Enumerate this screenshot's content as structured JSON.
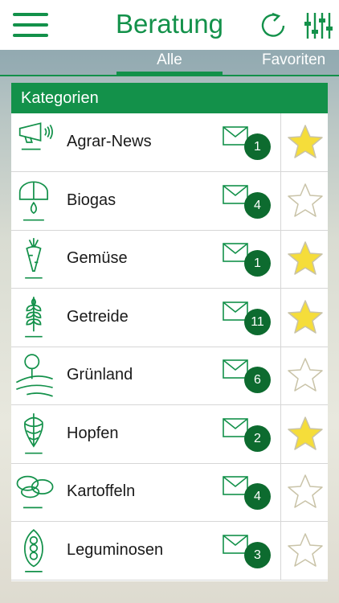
{
  "header": {
    "title": "Beratung",
    "menu_icon": "hamburger-menu-icon",
    "refresh_icon": "refresh-icon",
    "filter_icon": "sliders-icon"
  },
  "tabs": [
    {
      "label": "Alle",
      "active": true
    },
    {
      "label": "Favoriten",
      "active": false
    }
  ],
  "section": {
    "title": "Kategorien"
  },
  "colors": {
    "brand_green": "#13914a",
    "badge_green": "#0d6b2f",
    "star_filled": "#f5dd3a",
    "star_empty": "#ffffff"
  },
  "categories": [
    {
      "label": "Agrar-News",
      "count": "1",
      "favorite": true,
      "icon": "megaphone-icon"
    },
    {
      "label": "Biogas",
      "count": "4",
      "favorite": false,
      "icon": "biogas-tank-icon"
    },
    {
      "label": "Gemüse",
      "count": "1",
      "favorite": true,
      "icon": "carrot-icon"
    },
    {
      "label": "Getreide",
      "count": "11",
      "favorite": true,
      "icon": "wheat-icon"
    },
    {
      "label": "Grünland",
      "count": "6",
      "favorite": false,
      "icon": "tree-meadow-icon"
    },
    {
      "label": "Hopfen",
      "count": "2",
      "favorite": true,
      "icon": "hop-icon"
    },
    {
      "label": "Kartoffeln",
      "count": "4",
      "favorite": false,
      "icon": "potato-icon"
    },
    {
      "label": "Leguminosen",
      "count": "3",
      "favorite": false,
      "icon": "pea-pod-icon"
    }
  ]
}
